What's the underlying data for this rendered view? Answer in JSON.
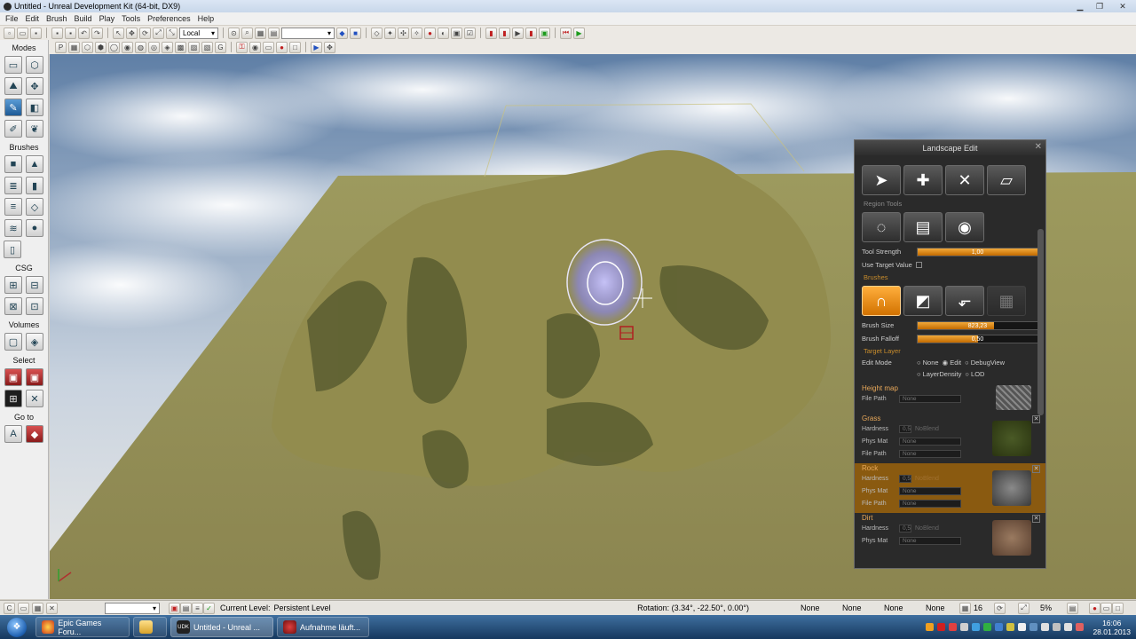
{
  "window": {
    "title": "Untitled - Unreal Development Kit (64-bit, DX9)"
  },
  "menu": [
    "File",
    "Edit",
    "Brush",
    "Build",
    "Play",
    "Tools",
    "Preferences",
    "Help"
  ],
  "toolbar": {
    "coord_mode": "Local"
  },
  "left_panel": {
    "modes_label": "Modes",
    "brushes_label": "Brushes",
    "csg_label": "CSG",
    "volumes_label": "Volumes",
    "select_label": "Select",
    "goto_label": "Go to"
  },
  "landscape": {
    "title": "Landscape Edit",
    "region_tools_label": "Region Tools",
    "tool_strength_label": "Tool Strength",
    "tool_strength_value": "1,00",
    "tool_strength_fraction": 1.0,
    "use_target_value_label": "Use Target Value",
    "brushes_label": "Brushes",
    "brush_size_label": "Brush Size",
    "brush_size_value": "823,23",
    "brush_size_fraction": 0.64,
    "brush_falloff_label": "Brush Falloff",
    "brush_falloff_value": "0,50",
    "brush_falloff_fraction": 0.5,
    "target_layer_label": "Target Layer",
    "edit_mode_label": "Edit Mode",
    "edit_mode_options": [
      "None",
      "Edit",
      "DebugView",
      "LayerDensity",
      "LOD"
    ],
    "edit_mode_selected": "Edit",
    "layers": [
      {
        "name": "Height map",
        "file_path_label": "File Path",
        "file_path": "None"
      },
      {
        "name": "Grass",
        "hardness_label": "Hardness",
        "hardness": "0,5",
        "no_blend": "NoBlend",
        "phys_mat_label": "Phys Mat",
        "phys_mat": "None",
        "file_path_label": "File Path",
        "file_path": "None"
      },
      {
        "name": "Rock",
        "hardness_label": "Hardness",
        "hardness": "0,5",
        "no_blend": "NoBlend",
        "phys_mat_label": "Phys Mat",
        "phys_mat": "None",
        "file_path_label": "File Path",
        "file_path": "None",
        "selected": true
      },
      {
        "name": "Dirt",
        "hardness_label": "Hardness",
        "hardness": "0,5",
        "no_blend": "NoBlend",
        "phys_mat_label": "Phys Mat",
        "phys_mat": "None"
      }
    ]
  },
  "statusbar": {
    "current_level_label": "Current Level:",
    "current_level": "Persistent Level",
    "rotation": "Rotation: (3.34°, -22.50°, 0.00°)",
    "none_fields": [
      "None",
      "None",
      "None",
      "None"
    ],
    "grid_value": "16",
    "zoom_value": "5%"
  },
  "taskbar": {
    "items": [
      {
        "label": "Epic Games Foru..."
      },
      {
        "label": ""
      },
      {
        "label": "Untitled - Unreal ..."
      },
      {
        "label": "Aufnahme läuft..."
      }
    ],
    "time": "16:06",
    "date": "28.01.2013"
  },
  "colors": {
    "accent_orange": "#e28b16",
    "panel_dark": "#2a2a2a",
    "taskbar": "#1d4670"
  }
}
